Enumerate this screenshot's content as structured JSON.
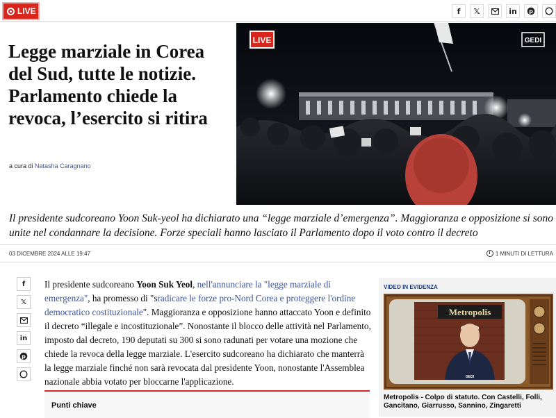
{
  "topbar": {
    "live_label": "LIVE",
    "share_icons": [
      "facebook-icon",
      "x-icon",
      "email-icon",
      "linkedin-icon",
      "pinterest-icon",
      "whatsapp-icon"
    ]
  },
  "hero": {
    "headline": "Legge marziale in Corea del Sud, tutte le notizie. Parlamento chiede la revoca, l’esercito si ritira",
    "byline_prefix": "a cura di",
    "author": "Natasha Caragnano",
    "image_live_badge": "LIVE",
    "image_logo": "GEDI"
  },
  "subhead": "Il presidente sudcoreano Yoon Suk-yeol ha dichiarato una “legge marziale d’emergenza”. Maggioranza e opposizione si sono unite nel condannare la decisione. Forze speciali hanno lasciato il Parlamento dopo il voto contro il decreto",
  "meta": {
    "date": "03 DICEMBRE 2024 ALLE 19:47",
    "read_time": "1 MINUTI DI LETTURA"
  },
  "article": {
    "p1": "Il presidente sudcoreano ",
    "p2": "Yoon Suk Yeol",
    "p3": ", ",
    "p4": "nell'annunciare la \"legge marziale di emergenza\"",
    "p5": ", ha promesso di \"s",
    "p6": "radicare le forze pro-Nord Corea e proteggere l'ordine democratico costituzionale",
    "p7": "\". Maggioranza e opposizione hanno attaccato Yoon e definito il decreto “illegale e incostituzionale”. Nonostante il blocco delle attività nel Parlamento, imposto dal decreto, 190 deputati su 300 si sono radunati per votare una mozione che chiede la revoca della legge marziale. L'esercito sudcoreano ha dichiarato che manterrà la legge marziale finché non sarà revocata dal presidente Yoon, nonostante l'Assemblea nazionale abbia votato per bloccarne l'applicazione."
  },
  "keypoints": {
    "title": "Punti chiave"
  },
  "aside": {
    "label": "VIDEO IN EVIDENZA",
    "show_name": "Metropolis",
    "logo": "GEDI",
    "caption": "Metropolis - Colpo di statuto. Con Castelli, Folli, Gancitano, Giarrusso, Sannino, Zingaretti"
  },
  "colors": {
    "accent": "#d9261c",
    "link": "#3a54a0"
  }
}
